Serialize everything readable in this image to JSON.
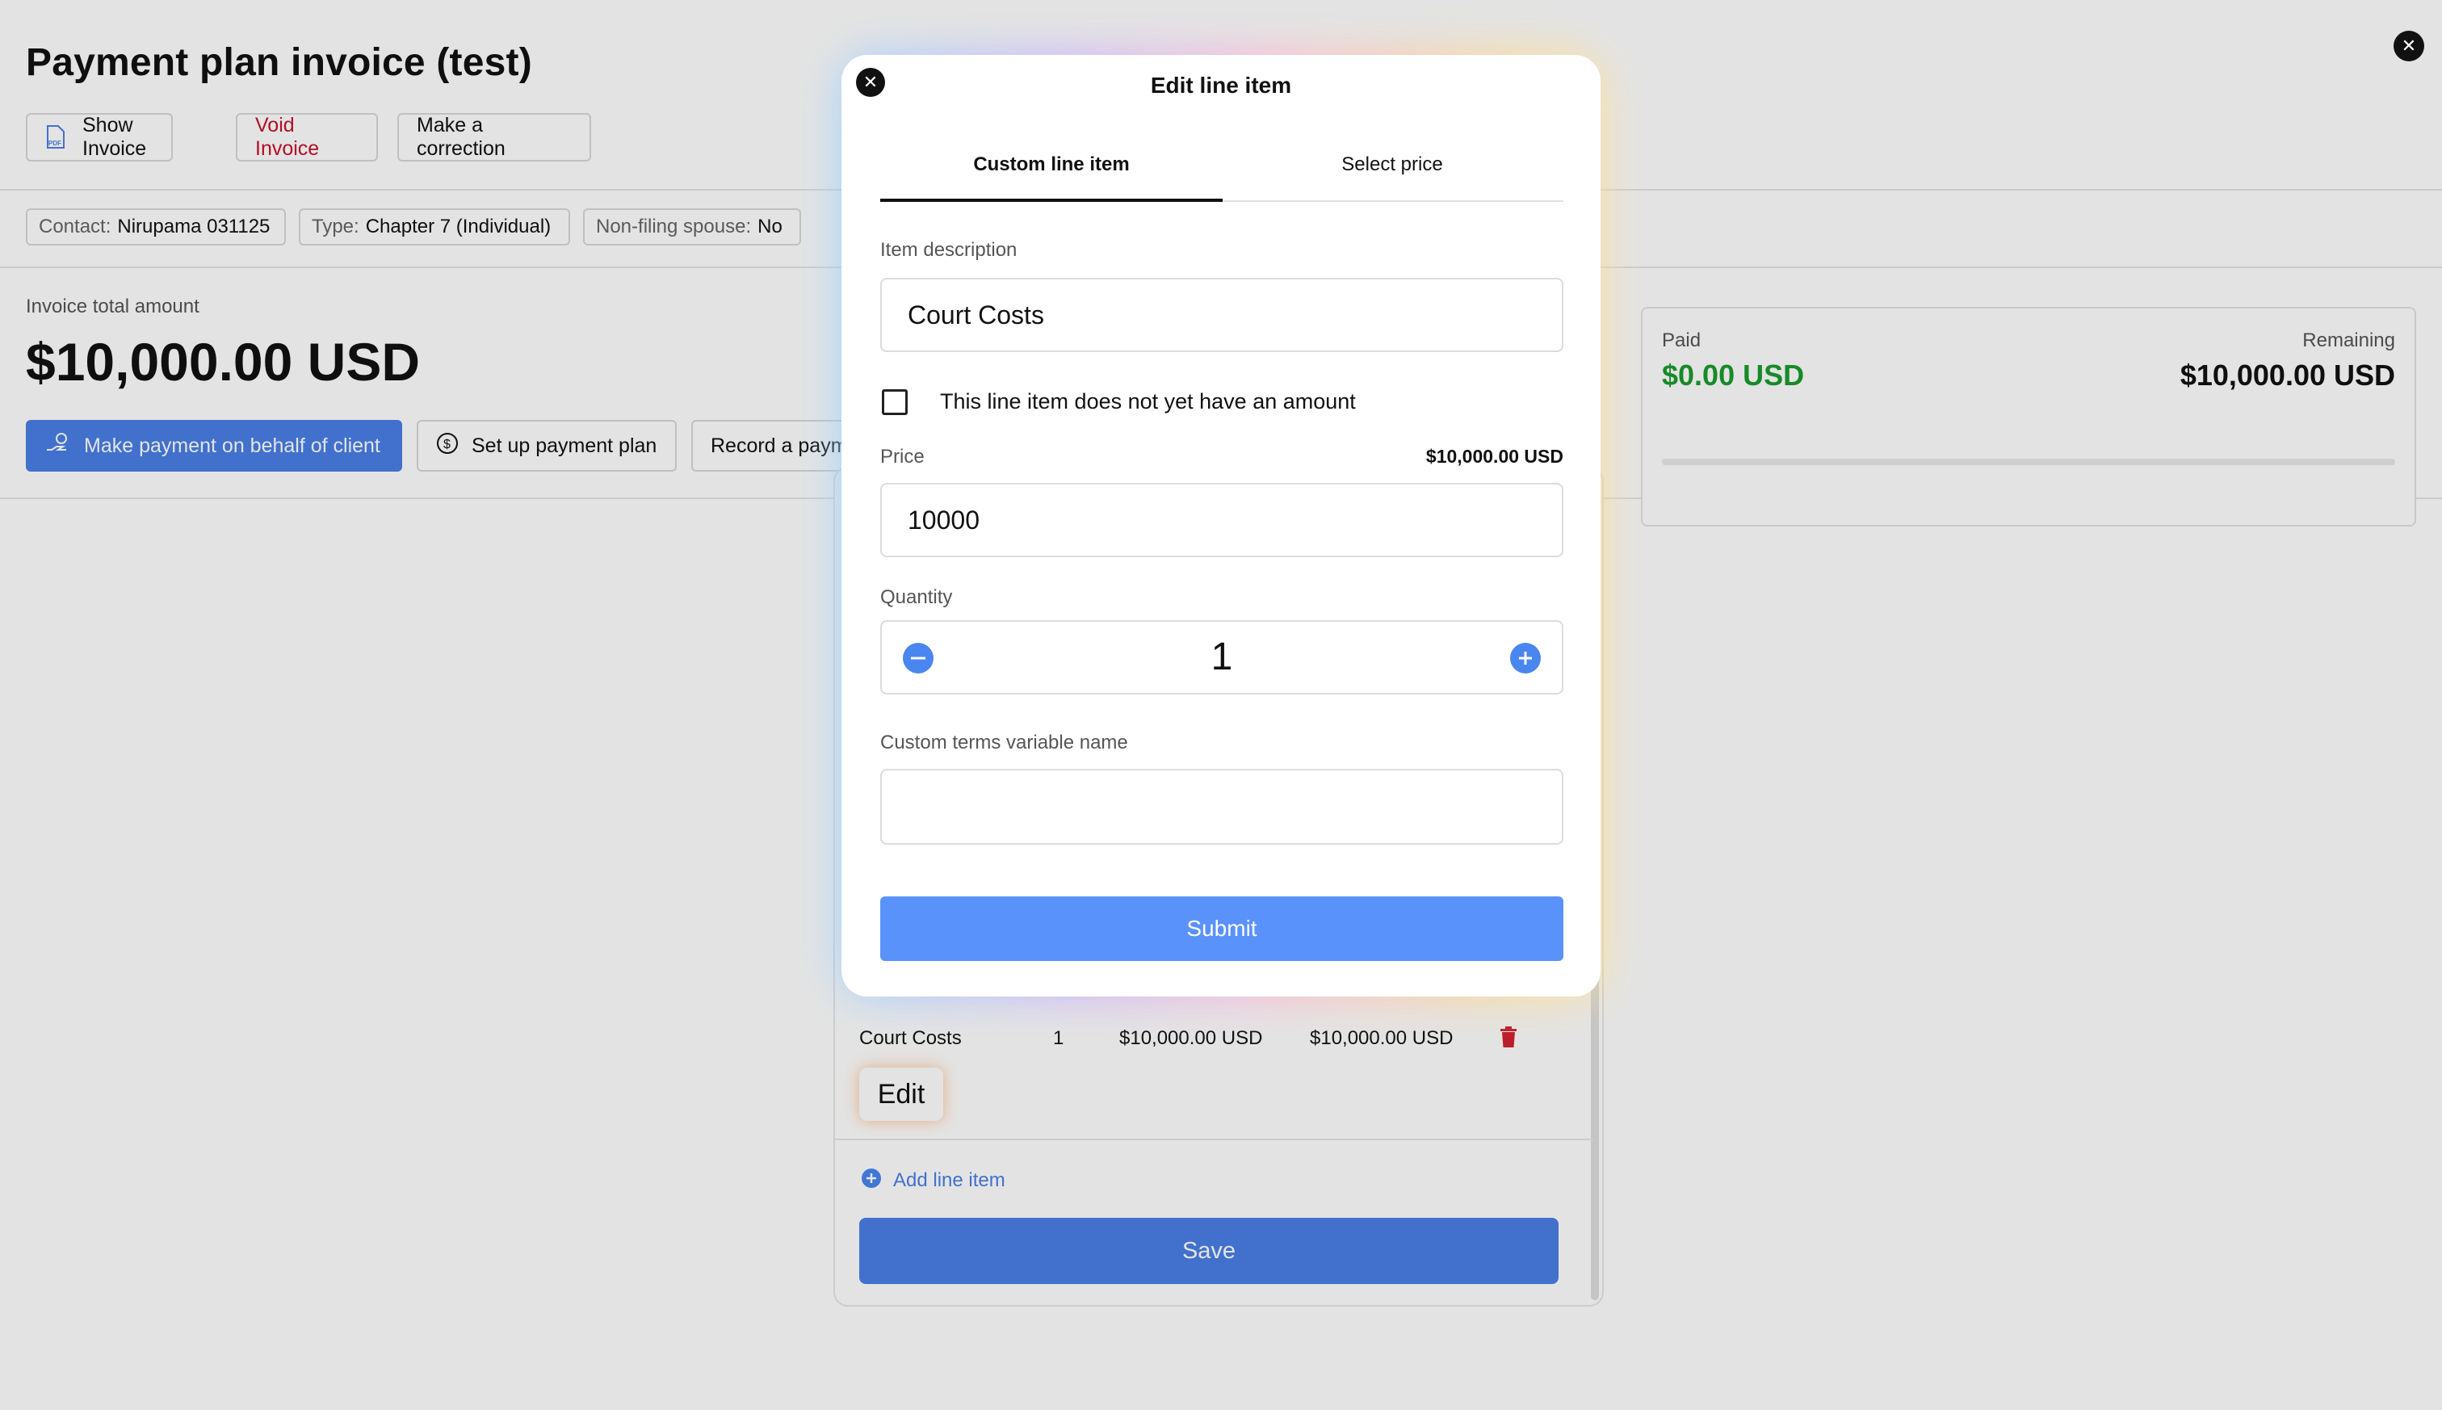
{
  "page": {
    "title": "Payment plan invoice (test)",
    "actions": {
      "show_invoice": "Show Invoice",
      "void_invoice": "Void Invoice",
      "make_correction": "Make a correction"
    },
    "chips": {
      "contact_key": "Contact:",
      "contact_value": "Nirupama 031125",
      "type_key": "Type:",
      "type_value": "Chapter 7 (Individual)",
      "spouse_key": "Non-filing spouse:",
      "spouse_value": "No"
    },
    "total_label": "Invoice total amount",
    "total_amount": "$10,000.00 USD",
    "payment_buttons": {
      "make_payment": "Make payment on behalf of client",
      "setup_plan": "Set up payment plan",
      "record_payment": "Record a payment"
    },
    "summary": {
      "paid_label": "Paid",
      "paid_value": "$0.00 USD",
      "remaining_label": "Remaining",
      "remaining_value": "$10,000.00 USD",
      "paid_fraction": 0
    }
  },
  "line_items_panel": {
    "row": {
      "description": "Court Costs",
      "quantity": "1",
      "unit_price": "$10,000.00 USD",
      "total": "$10,000.00 USD"
    },
    "edit_label": "Edit",
    "add_line_item": "Add line item",
    "save_label": "Save"
  },
  "modal": {
    "title": "Edit line item",
    "tabs": [
      "Custom line item",
      "Select price"
    ],
    "active_tab": 0,
    "item_description_label": "Item description",
    "item_description_value": "Court Costs",
    "no_amount_checkbox_label": "This line item does not yet have an amount",
    "no_amount_checked": false,
    "price_label": "Price",
    "price_formatted": "$10,000.00 USD",
    "price_value": "10000",
    "quantity_label": "Quantity",
    "quantity_value": "1",
    "custom_terms_label": "Custom terms variable name",
    "custom_terms_value": "",
    "submit_label": "Submit"
  },
  "colors": {
    "primary": "#4a7fe6",
    "paid_green": "#1a9c2e",
    "danger_red": "#c8102e",
    "overlay": "rgba(0,0,0,0.11)"
  },
  "icons": [
    "pdf-icon",
    "hand-coin-icon",
    "dollar-circle-icon",
    "trash-icon",
    "plus-circle-icon",
    "close-icon",
    "minus-icon",
    "plus-icon"
  ]
}
